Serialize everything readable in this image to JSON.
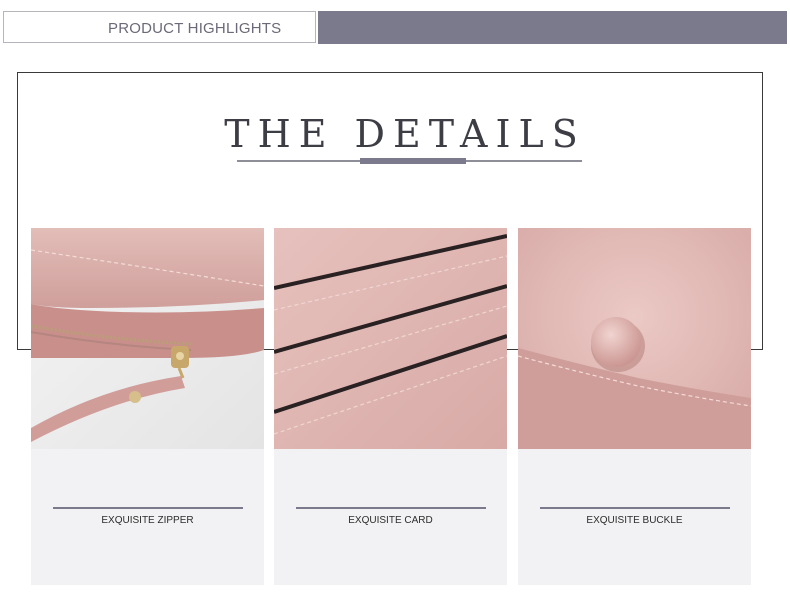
{
  "header": {
    "title": "PRODUCT HIGHLIGHTS",
    "accent_color": "#7b7a8c"
  },
  "details": {
    "title": "THE DETAILS"
  },
  "cards": [
    {
      "label": "EXQUISITE ZIPPER",
      "image": "wallet-zipper-photo"
    },
    {
      "label": "EXQUISITE CARD",
      "image": "wallet-card-slots-photo"
    },
    {
      "label": "EXQUISITE BUCKLE",
      "image": "wallet-button-buckle-photo"
    }
  ],
  "colors": {
    "wallet_pink": "#d9a9a6",
    "card_bg": "#f2f2f4"
  }
}
